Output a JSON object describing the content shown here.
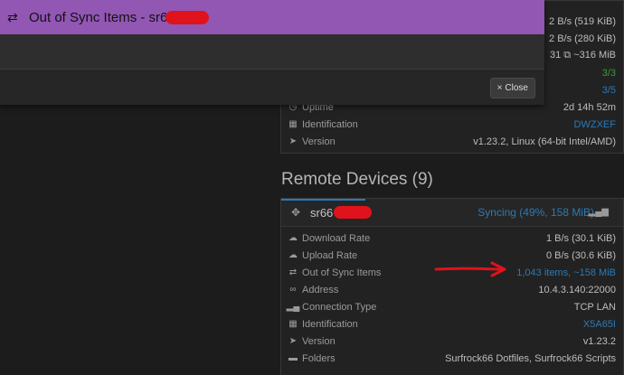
{
  "this_device": {
    "rows": [
      {
        "label": "",
        "value": "2 B/s (519 KiB)",
        "icon": "none"
      },
      {
        "label": "",
        "value": "2 B/s (280 KiB)",
        "icon": "none"
      },
      {
        "label": "",
        "value": "31  ⧉ ~316 MiB",
        "icon": "none"
      },
      {
        "label": "",
        "value": "3/3",
        "icon": "none",
        "color": "#3c9a3c"
      },
      {
        "label": "",
        "value": "3/5",
        "icon": "none",
        "color": "#2a7ab8"
      },
      {
        "label": "Uptime",
        "value": "2d 14h 52m",
        "icon": "clock"
      },
      {
        "label": "Identification",
        "value": "DWZXEF",
        "icon": "qrcode",
        "color": "#2a7ab8"
      },
      {
        "label": "Version",
        "value": "v1.23.2, Linux (64-bit Intel/AMD)",
        "icon": "tag"
      }
    ]
  },
  "remote": {
    "heading": "Remote Devices (9)",
    "device_name": "sr66",
    "status": "Syncing (49%, 158 MiB)",
    "progress": 0.49,
    "rows": [
      {
        "label": "Download Rate",
        "value": "1 B/s (30.1 KiB)",
        "icon": "download"
      },
      {
        "label": "Upload Rate",
        "value": "0 B/s (30.6 KiB)",
        "icon": "upload"
      },
      {
        "label": "Out of Sync Items",
        "value": "1,043 items, ~158 MiB",
        "icon": "exchange",
        "color": "#2a7ab8"
      },
      {
        "label": "Address",
        "value": "10.4.3.140:22000",
        "icon": "link"
      },
      {
        "label": "Connection Type",
        "value": "TCP LAN",
        "icon": "signal"
      },
      {
        "label": "Identification",
        "value": "X5A65I",
        "icon": "qrcode",
        "color": "#2a7ab8"
      },
      {
        "label": "Version",
        "value": "v1.23.2",
        "icon": "tag"
      },
      {
        "label": "Folders",
        "value": "Surfrock66 Dotfiles, Surfrock66 Scripts",
        "icon": "folder"
      }
    ]
  },
  "modal": {
    "title": "Out of Sync Items - sr66",
    "close_label": "Close",
    "close_icon": "×"
  },
  "annotation": {
    "color": "#e0121c"
  }
}
